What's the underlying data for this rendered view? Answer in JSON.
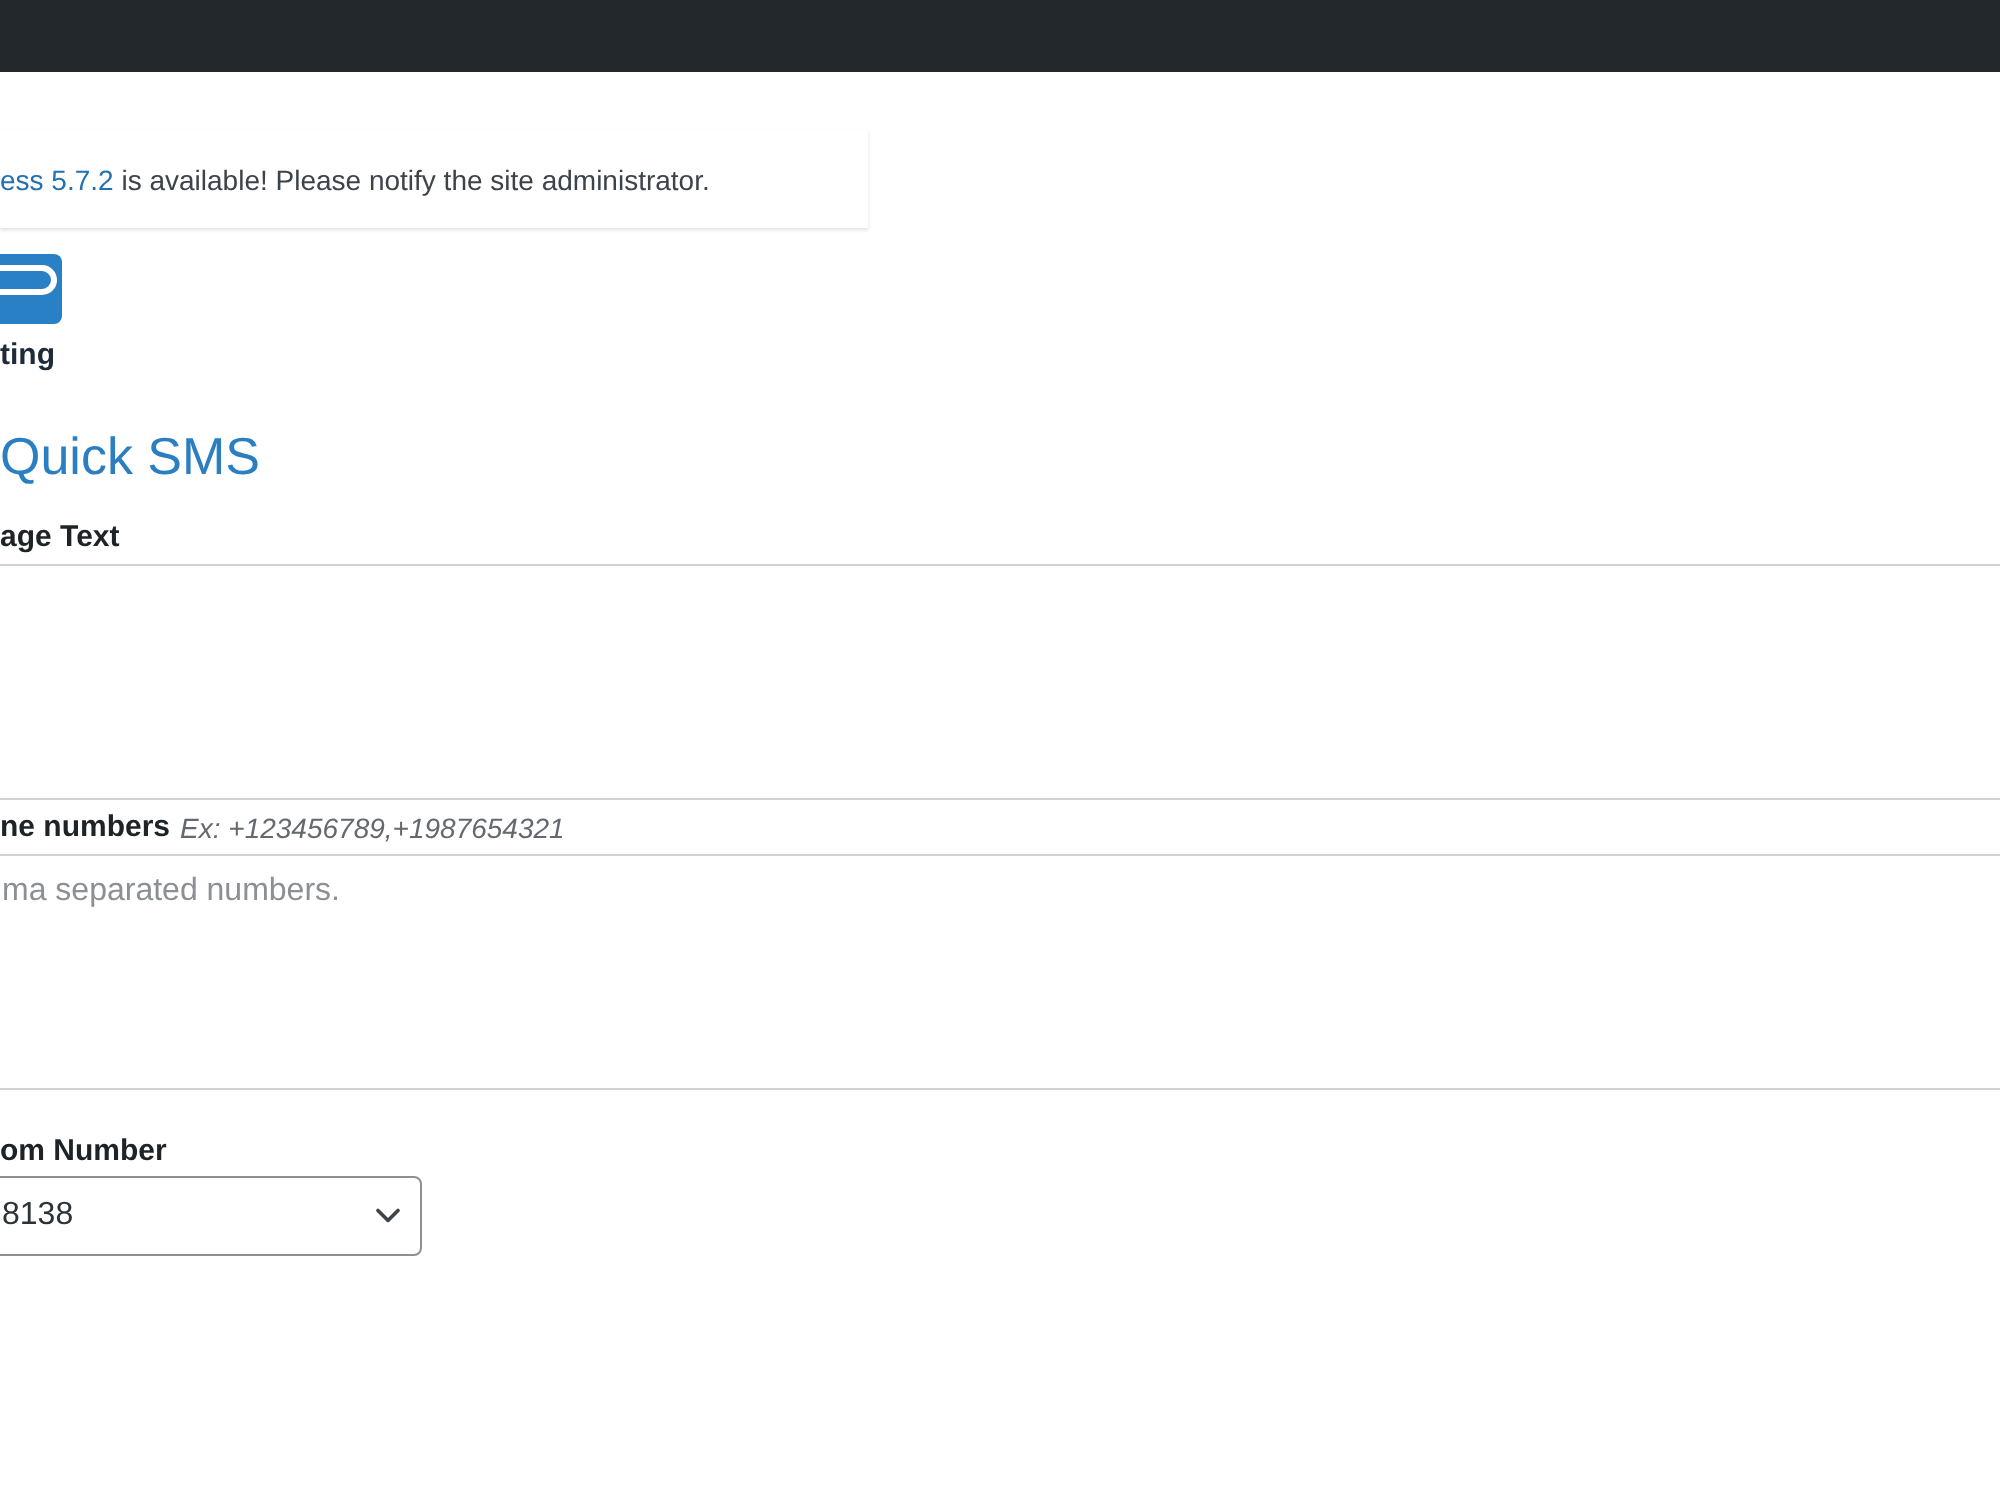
{
  "notice": {
    "link": "ess 5.7.2",
    "text": "is available! Please notify the site administrator."
  },
  "logo": {
    "text": "ting"
  },
  "heading": "Quick SMS",
  "form": {
    "fields": [
      {
        "kind": "textarea",
        "label": "age Text"
      },
      {
        "kind": "textarea",
        "label": "ne numbers",
        "hint": "Ex: +123456789,+1987654321",
        "placeholder": "ma separated numbers."
      },
      {
        "kind": "select",
        "label": "om Number",
        "value": "8138"
      }
    ]
  }
}
